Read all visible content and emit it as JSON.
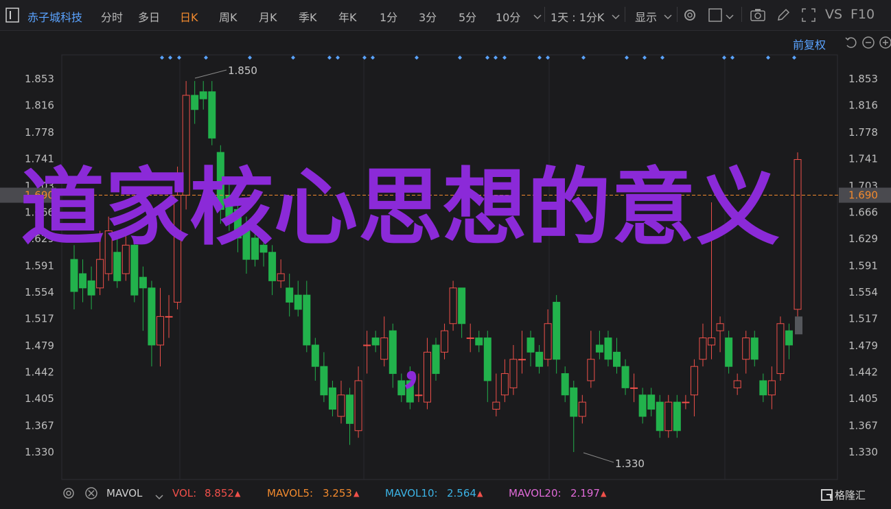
{
  "toolbar": {
    "stock_name": "赤子城科技",
    "periods": [
      "分时",
      "多日",
      "日K",
      "周K",
      "月K",
      "季K",
      "年K",
      "1分",
      "3分",
      "5分",
      "10分"
    ],
    "active_period": "日K",
    "interval_label": "1天 : 1分K",
    "display_label": "显示",
    "vs_label": "VS",
    "f10_label": "F10"
  },
  "adjust_label": "前复权",
  "overlay_title": "道家核心思想的意义",
  "overlay_comma": "，",
  "current_price_tag": "1.690",
  "high_label": "1.850",
  "low_label": "1.330",
  "volume_indicator": {
    "name": "MAVOL",
    "vol_label": "VOL:",
    "vol_value": "8.852",
    "mavol5_label": "MAVOL5:",
    "mavol5_value": "3.253",
    "mavol10_label": "MAVOL10:",
    "mavol10_value": "2.564",
    "mavol20_label": "MAVOL20:",
    "mavol20_value": "2.197"
  },
  "watermark": "格隆汇",
  "colors": {
    "up": "#f0504a",
    "down": "#22b24c",
    "accent": "#f28a2e",
    "link": "#5aa3ff",
    "overlay": "#8b2ad8"
  },
  "chart_data": {
    "type": "candlestick",
    "y_ticks": [
      "1.853",
      "1.816",
      "1.778",
      "1.741",
      "1.703",
      "1.666",
      "1.629",
      "1.591",
      "1.554",
      "1.517",
      "1.479",
      "1.442",
      "1.405",
      "1.367",
      "1.330"
    ],
    "ylim": [
      1.31,
      1.88
    ],
    "candles": [
      {
        "o": 1.6,
        "c": 1.555,
        "h": 1.62,
        "l": 1.53
      },
      {
        "o": 1.58,
        "c": 1.56,
        "h": 1.6,
        "l": 1.54
      },
      {
        "o": 1.57,
        "c": 1.55,
        "h": 1.59,
        "l": 1.53
      },
      {
        "o": 1.56,
        "c": 1.6,
        "h": 1.64,
        "l": 1.55
      },
      {
        "o": 1.58,
        "c": 1.64,
        "h": 1.66,
        "l": 1.57
      },
      {
        "o": 1.61,
        "c": 1.57,
        "h": 1.63,
        "l": 1.56
      },
      {
        "o": 1.58,
        "c": 1.62,
        "h": 1.64,
        "l": 1.57
      },
      {
        "o": 1.62,
        "c": 1.55,
        "h": 1.63,
        "l": 1.54
      },
      {
        "o": 1.575,
        "c": 1.56,
        "h": 1.59,
        "l": 1.5
      },
      {
        "o": 1.56,
        "c": 1.48,
        "h": 1.57,
        "l": 1.45
      },
      {
        "o": 1.48,
        "c": 1.52,
        "h": 1.56,
        "l": 1.45
      },
      {
        "o": 1.52,
        "c": 1.52,
        "h": 1.55,
        "l": 1.49
      },
      {
        "o": 1.54,
        "c": 1.69,
        "h": 1.73,
        "l": 1.53
      },
      {
        "o": 1.69,
        "c": 1.83,
        "h": 1.85,
        "l": 1.67
      },
      {
        "o": 1.83,
        "c": 1.81,
        "h": 1.85,
        "l": 1.79
      },
      {
        "o": 1.835,
        "c": 1.825,
        "h": 1.85,
        "l": 1.81
      },
      {
        "o": 1.835,
        "c": 1.77,
        "h": 1.85,
        "l": 1.76
      },
      {
        "o": 1.75,
        "c": 1.67,
        "h": 1.76,
        "l": 1.65
      },
      {
        "o": 1.69,
        "c": 1.66,
        "h": 1.71,
        "l": 1.64
      },
      {
        "o": 1.67,
        "c": 1.63,
        "h": 1.69,
        "l": 1.61
      },
      {
        "o": 1.64,
        "c": 1.6,
        "h": 1.66,
        "l": 1.58
      },
      {
        "o": 1.63,
        "c": 1.6,
        "h": 1.65,
        "l": 1.59
      },
      {
        "o": 1.62,
        "c": 1.61,
        "h": 1.64,
        "l": 1.59
      },
      {
        "o": 1.61,
        "c": 1.57,
        "h": 1.62,
        "l": 1.55
      },
      {
        "o": 1.57,
        "c": 1.58,
        "h": 1.6,
        "l": 1.56
      },
      {
        "o": 1.56,
        "c": 1.54,
        "h": 1.58,
        "l": 1.52
      },
      {
        "o": 1.55,
        "c": 1.53,
        "h": 1.57,
        "l": 1.52
      },
      {
        "o": 1.55,
        "c": 1.48,
        "h": 1.57,
        "l": 1.47
      },
      {
        "o": 1.48,
        "c": 1.45,
        "h": 1.49,
        "l": 1.43
      },
      {
        "o": 1.45,
        "c": 1.41,
        "h": 1.47,
        "l": 1.4
      },
      {
        "o": 1.42,
        "c": 1.39,
        "h": 1.43,
        "l": 1.38
      },
      {
        "o": 1.38,
        "c": 1.41,
        "h": 1.43,
        "l": 1.37
      },
      {
        "o": 1.41,
        "c": 1.37,
        "h": 1.42,
        "l": 1.34
      },
      {
        "o": 1.36,
        "c": 1.43,
        "h": 1.45,
        "l": 1.35
      },
      {
        "o": 1.48,
        "c": 1.48,
        "h": 1.5,
        "l": 1.44
      },
      {
        "o": 1.49,
        "c": 1.48,
        "h": 1.5,
        "l": 1.47
      },
      {
        "o": 1.46,
        "c": 1.49,
        "h": 1.52,
        "l": 1.45
      },
      {
        "o": 1.5,
        "c": 1.44,
        "h": 1.51,
        "l": 1.42
      },
      {
        "o": 1.43,
        "c": 1.41,
        "h": 1.44,
        "l": 1.4
      },
      {
        "o": 1.43,
        "c": 1.4,
        "h": 1.45,
        "l": 1.39
      },
      {
        "o": 1.41,
        "c": 1.41,
        "h": 1.44,
        "l": 1.4
      },
      {
        "o": 1.4,
        "c": 1.47,
        "h": 1.49,
        "l": 1.39
      },
      {
        "o": 1.48,
        "c": 1.44,
        "h": 1.49,
        "l": 1.43
      },
      {
        "o": 1.47,
        "c": 1.5,
        "h": 1.51,
        "l": 1.46
      },
      {
        "o": 1.51,
        "c": 1.56,
        "h": 1.57,
        "l": 1.5
      },
      {
        "o": 1.56,
        "c": 1.51,
        "h": 1.56,
        "l": 1.49
      },
      {
        "o": 1.49,
        "c": 1.49,
        "h": 1.51,
        "l": 1.47
      },
      {
        "o": 1.49,
        "c": 1.48,
        "h": 1.5,
        "l": 1.47
      },
      {
        "o": 1.49,
        "c": 1.43,
        "h": 1.5,
        "l": 1.4
      },
      {
        "o": 1.39,
        "c": 1.4,
        "h": 1.44,
        "l": 1.38
      },
      {
        "o": 1.41,
        "c": 1.44,
        "h": 1.46,
        "l": 1.4
      },
      {
        "o": 1.42,
        "c": 1.46,
        "h": 1.48,
        "l": 1.41
      },
      {
        "o": 1.46,
        "c": 1.46,
        "h": 1.5,
        "l": 1.44
      },
      {
        "o": 1.49,
        "c": 1.47,
        "h": 1.5,
        "l": 1.45
      },
      {
        "o": 1.47,
        "c": 1.45,
        "h": 1.48,
        "l": 1.44
      },
      {
        "o": 1.46,
        "c": 1.51,
        "h": 1.53,
        "l": 1.45
      },
      {
        "o": 1.54,
        "c": 1.46,
        "h": 1.55,
        "l": 1.44
      },
      {
        "o": 1.44,
        "c": 1.41,
        "h": 1.45,
        "l": 1.4
      },
      {
        "o": 1.42,
        "c": 1.38,
        "h": 1.43,
        "l": 1.33
      },
      {
        "o": 1.38,
        "c": 1.4,
        "h": 1.41,
        "l": 1.37
      },
      {
        "o": 1.43,
        "c": 1.46,
        "h": 1.5,
        "l": 1.42
      },
      {
        "o": 1.48,
        "c": 1.47,
        "h": 1.5,
        "l": 1.46
      },
      {
        "o": 1.49,
        "c": 1.46,
        "h": 1.5,
        "l": 1.45
      },
      {
        "o": 1.47,
        "c": 1.45,
        "h": 1.49,
        "l": 1.44
      },
      {
        "o": 1.45,
        "c": 1.42,
        "h": 1.46,
        "l": 1.41
      },
      {
        "o": 1.42,
        "c": 1.42,
        "h": 1.44,
        "l": 1.4
      },
      {
        "o": 1.41,
        "c": 1.38,
        "h": 1.42,
        "l": 1.37
      },
      {
        "o": 1.41,
        "c": 1.39,
        "h": 1.42,
        "l": 1.38
      },
      {
        "o": 1.4,
        "c": 1.36,
        "h": 1.41,
        "l": 1.35
      },
      {
        "o": 1.36,
        "c": 1.4,
        "h": 1.41,
        "l": 1.35
      },
      {
        "o": 1.4,
        "c": 1.36,
        "h": 1.41,
        "l": 1.35
      },
      {
        "o": 1.4,
        "c": 1.4,
        "h": 1.41,
        "l": 1.39
      },
      {
        "o": 1.41,
        "c": 1.45,
        "h": 1.46,
        "l": 1.38
      },
      {
        "o": 1.46,
        "c": 1.49,
        "h": 1.51,
        "l": 1.45
      },
      {
        "o": 1.48,
        "c": 1.49,
        "h": 1.68,
        "l": 1.46
      },
      {
        "o": 1.5,
        "c": 1.51,
        "h": 1.52,
        "l": 1.47
      },
      {
        "o": 1.49,
        "c": 1.45,
        "h": 1.5,
        "l": 1.44
      },
      {
        "o": 1.42,
        "c": 1.43,
        "h": 1.44,
        "l": 1.41
      },
      {
        "o": 1.46,
        "c": 1.49,
        "h": 1.5,
        "l": 1.44
      },
      {
        "o": 1.49,
        "c": 1.46,
        "h": 1.5,
        "l": 1.45
      },
      {
        "o": 1.43,
        "c": 1.41,
        "h": 1.44,
        "l": 1.4
      },
      {
        "o": 1.41,
        "c": 1.43,
        "h": 1.45,
        "l": 1.39
      },
      {
        "o": 1.44,
        "c": 1.51,
        "h": 1.52,
        "l": 1.43
      },
      {
        "o": 1.5,
        "c": 1.48,
        "h": 1.51,
        "l": 1.46
      },
      {
        "o": 1.53,
        "c": 1.74,
        "h": 1.75,
        "l": 1.52
      }
    ]
  }
}
